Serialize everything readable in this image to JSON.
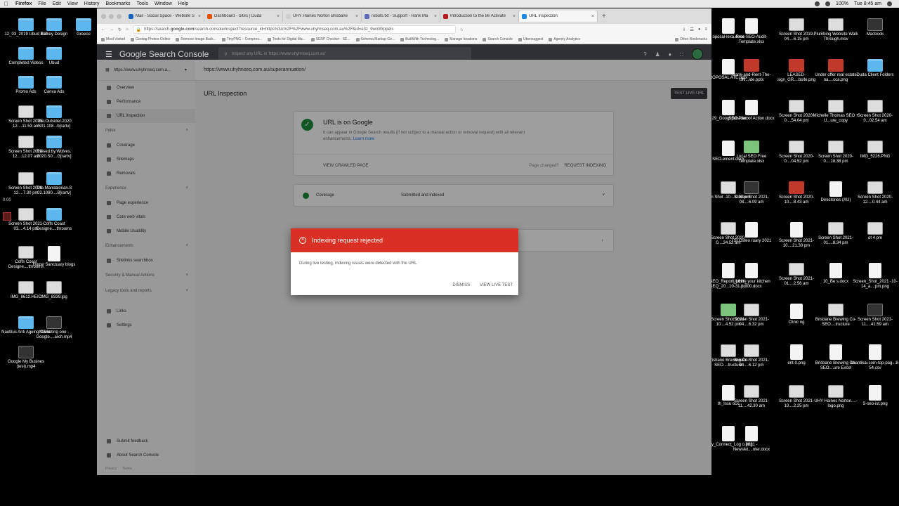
{
  "menubar": {
    "items": [
      "Firefox",
      "File",
      "Edit",
      "View",
      "History",
      "Bookmarks",
      "Tools",
      "Window",
      "Help"
    ],
    "battery": "100%",
    "clock": "Tue 8:45 am"
  },
  "desktop_left": [
    {
      "label": "12_03_2019 Ubud Bali",
      "kind": "folder"
    },
    {
      "label": "Turkey Design",
      "kind": "folder"
    },
    {
      "label": "Greece",
      "kind": "folder"
    },
    {
      "label": "Completed Videos",
      "kind": "folder"
    },
    {
      "label": "Ubud",
      "kind": "folder"
    },
    {
      "label": "Promo Ads",
      "kind": "folder"
    },
    {
      "label": "Canva Ads",
      "kind": "folder"
    },
    {
      "label": "Screen Shot 2020-12....11.53 am",
      "kind": "img"
    },
    {
      "label": "The.Outsider.2020 S01.108...b[rartv]",
      "kind": "folder"
    },
    {
      "label": "Screen Shot 2020-12....12.07 am",
      "kind": "img"
    },
    {
      "label": "Raised.by.Wolves. 2020.S0....G[rartv]",
      "kind": "folder"
    },
    {
      "label": "Screen Shot 2020-12....7.30 pm",
      "kind": "img"
    },
    {
      "label": "The.Mandalorian.S 02.1080....B[rartv]",
      "kind": "folder"
    },
    {
      "label": "Screen Shot 2021-03....4.14 pm",
      "kind": "img"
    },
    {
      "label": "Coffs Coast Designe....throoms",
      "kind": "folder"
    },
    {
      "label": "Coffs Coast Designe....throoms",
      "kind": "img"
    },
    {
      "label": "Home Sanctuary blogs",
      "kind": "doc"
    },
    {
      "label": "IMG_8612.HEIC",
      "kind": "img"
    },
    {
      "label": "IMG_8339.jpg",
      "kind": "img"
    },
    {
      "label": "Nautilus Anti Ageing Clinic",
      "kind": "folder"
    },
    {
      "label": "MArketing one - Google....arch.mp4",
      "kind": "dark"
    },
    {
      "label": "Google My Busines (test).mp4",
      "kind": "dark"
    }
  ],
  "desktop_right": [
    {
      "label": "oposal-lexa.docx",
      "kind": "doc"
    },
    {
      "label": "Free-SEO-Audit-Template.xlsx",
      "kind": "doc"
    },
    {
      "label": "Screen Shot 2019-04....6.15 pm",
      "kind": "img"
    },
    {
      "label": "Plumbing Website Walk Through.mov",
      "kind": "img"
    },
    {
      "label": "Macbook",
      "kind": "dark"
    },
    {
      "label": "ROPOSAL ATE.pptx",
      "kind": "doc"
    },
    {
      "label": "Rank-and-Rent-The-Ulti...ide.pptx",
      "kind": "red"
    },
    {
      "label": "LEASED-sign_GR....bsite.png",
      "kind": "red"
    },
    {
      "label": "Under offer real estate na....cca.png",
      "kind": "red"
    },
    {
      "label": "Duda Client Folders",
      "kind": "folder"
    },
    {
      "label": "5429_Googl pets.docx",
      "kind": "doc"
    },
    {
      "label": "SEO Plan of Action.docx",
      "kind": "doc"
    },
    {
      "label": "Screen Shot 2020-0....54.04 pm",
      "kind": "img"
    },
    {
      "label": "Michelle Thomas SEO + U...ure_copy",
      "kind": "img"
    },
    {
      "label": "Screen Shot 2020-0...02.54 am",
      "kind": "img"
    },
    {
      "label": "SEO-ement.docx",
      "kind": "doc"
    },
    {
      "label": "Local SEO Free Template.xlsx",
      "kind": "green"
    },
    {
      "label": "Screen Shot 2020-0....04.52 pm",
      "kind": "img"
    },
    {
      "label": "Screen Shot 2020-0....18.38 pm",
      "kind": "img"
    },
    {
      "label": "IMG_5226.PNG",
      "kind": "img"
    },
    {
      "label": "een Shot -10....0.20 pm",
      "kind": "img"
    },
    {
      "label": "Screen Shot 2021-08....6.09 am",
      "kind": "dark"
    },
    {
      "label": "Screen Shot 2020-10....8.43 am",
      "kind": "red"
    },
    {
      "label": "Directories (AU)",
      "kind": "doc"
    },
    {
      "label": "Screen Shot 2020-12....0.44 am",
      "kind": "img"
    },
    {
      "label": "Screen Shot 2020-0....34.52 am",
      "kind": "img"
    },
    {
      "label": "l St Osteo ruary 2021",
      "kind": "doc"
    },
    {
      "label": "Screen Shot 2021-10....21.30 pm",
      "kind": "doc"
    },
    {
      "label": "Screen Shot 2021-01....8.34 pm",
      "kind": "img"
    },
    {
      "label": "ot 4 pm",
      "kind": "img"
    },
    {
      "label": "SEO_Report_UHY_ SEQ_20...10-31.pdf",
      "kind": "doc"
    },
    {
      "label": "Update your kitchen f....00.docx",
      "kind": "doc"
    },
    {
      "label": "Screen Shot 2021-01....2.56 am",
      "kind": "img"
    },
    {
      "label": "10_Be s.docx",
      "kind": "doc"
    },
    {
      "label": "Screen_Shot_2021 -10-14_a....pm.png",
      "kind": "doc"
    },
    {
      "label": "Screen Shot 2021-10....4.52 pm",
      "kind": "green"
    },
    {
      "label": "Screen Shot 2021-04....6.32 pm",
      "kind": "img"
    },
    {
      "label": "Clinic ng",
      "kind": "doc"
    },
    {
      "label": "Brisbane Brewing Co- SEO....tructure",
      "kind": "img"
    },
    {
      "label": "Screen Shot 2021-11....41.59 am",
      "kind": "dark"
    },
    {
      "label": "Brisbane Brewing Co- SEO....tructure",
      "kind": "img"
    },
    {
      "label": "Screen Shot 2021-04....6.12 pm",
      "kind": "img"
    },
    {
      "label": "ent-0.png",
      "kind": "doc"
    },
    {
      "label": "Brisbane Brewing Co- SEO....ure Excel",
      "kind": "doc"
    },
    {
      "label": "shantikai.com-top-pag...8-54.csv",
      "kind": "doc"
    },
    {
      "label": "th_Issu ocx",
      "kind": "doc"
    },
    {
      "label": "Screen Shot 2021-11....42.30 am",
      "kind": "img"
    },
    {
      "label": "Screen Shot 2021-10....2.25 pm",
      "kind": "img"
    },
    {
      "label": "UHY Haines Norton....-logo.png",
      "kind": "img"
    },
    {
      "label": "S-seo-ist.png",
      "kind": "doc"
    },
    {
      "label": "Body_Connect_Log o.png",
      "kind": "doc"
    },
    {
      "label": "2021 - Newslet....nter.docx",
      "kind": "doc"
    }
  ],
  "browser": {
    "tabs": [
      {
        "title": "Mail - Social Space - Website S",
        "color": "#1565c0"
      },
      {
        "title": "Dashboard - Sites | Duda",
        "color": "#e65100"
      },
      {
        "title": "UHY Haines Norton Brisbane",
        "color": "#cfcfcf"
      },
      {
        "title": "robots.txt - Support - Rank Ma",
        "color": "#5c6bc0"
      },
      {
        "title": "Introduction to the 8e Activate",
        "color": "#b71c1c"
      },
      {
        "title": "URL Inspection",
        "color": "#1e88e5"
      }
    ],
    "url_prefix": "https://search.",
    "url_bold": "google.com",
    "url_rest": "/search-console/inspect?resource_id=https%3A%2F%2Fwww.uhyhnseq.com.au%2F&id=e3z_9wnWrppeIs",
    "bookmarks": [
      "Most Visited",
      "Geotag Photos Online",
      "Remove Image Back...",
      "TinyPNG – Compres...",
      "Tools for Digital Ma...",
      "SERP Checker - SE...",
      "Schema Markup Ge...",
      "BuiltWith Technolog...",
      "Manage locations",
      "Search Console",
      "Ubersuggest",
      "Agency Analytics",
      "Other Bookmarks"
    ]
  },
  "gsc": {
    "logo": "Google Search Console",
    "search_placeholder": "Inspect any URL in 'https://www.uhyhnseq.com.au'",
    "property": "https://www.uhyhnseq.com.a...",
    "nav_top": [
      "Overview",
      "Performance",
      "URL inspection"
    ],
    "index_label": "Index",
    "index_items": [
      "Coverage",
      "Sitemaps",
      "Removals"
    ],
    "experience_label": "Experience",
    "experience_items": [
      "Page experience",
      "Core web vitals",
      "Mobile Usability"
    ],
    "enhancements_label": "Enhancements",
    "enhancements_items": [
      "Sitelinks searchbox"
    ],
    "security_label": "Security & Manual Actions",
    "legacy_label": "Legacy tools and reports",
    "bottom_items": [
      "Links",
      "Settings"
    ],
    "footer_items": [
      "Submit feedback",
      "About Search Console"
    ],
    "privacy": "Privacy",
    "terms": "Terms",
    "breadcrumb": "https://www.uhyhnseq.com.au/superannuation/",
    "page_title": "URL Inspection",
    "test_live_url": "TEST LIVE URL",
    "status_title": "URL is on Google",
    "status_desc": "It can appear in Google Search results (if not subject to a manual action or removal request) with all relevant enhancements.",
    "learn_more": "Learn more",
    "view_crawled": "VIEW CRAWLED PAGE",
    "page_changed": "Page changed?",
    "request_indexing": "REQUEST INDEXING",
    "coverage_label": "Coverage",
    "coverage_value": "Submitted and indexed"
  },
  "dialog": {
    "title": "Indexing request rejected",
    "message": "During live testing, indexing issues were detected with the URL",
    "dismiss": "DISMISS",
    "view_live_test": "VIEW LIVE TEST"
  },
  "recording_time": "0:00"
}
